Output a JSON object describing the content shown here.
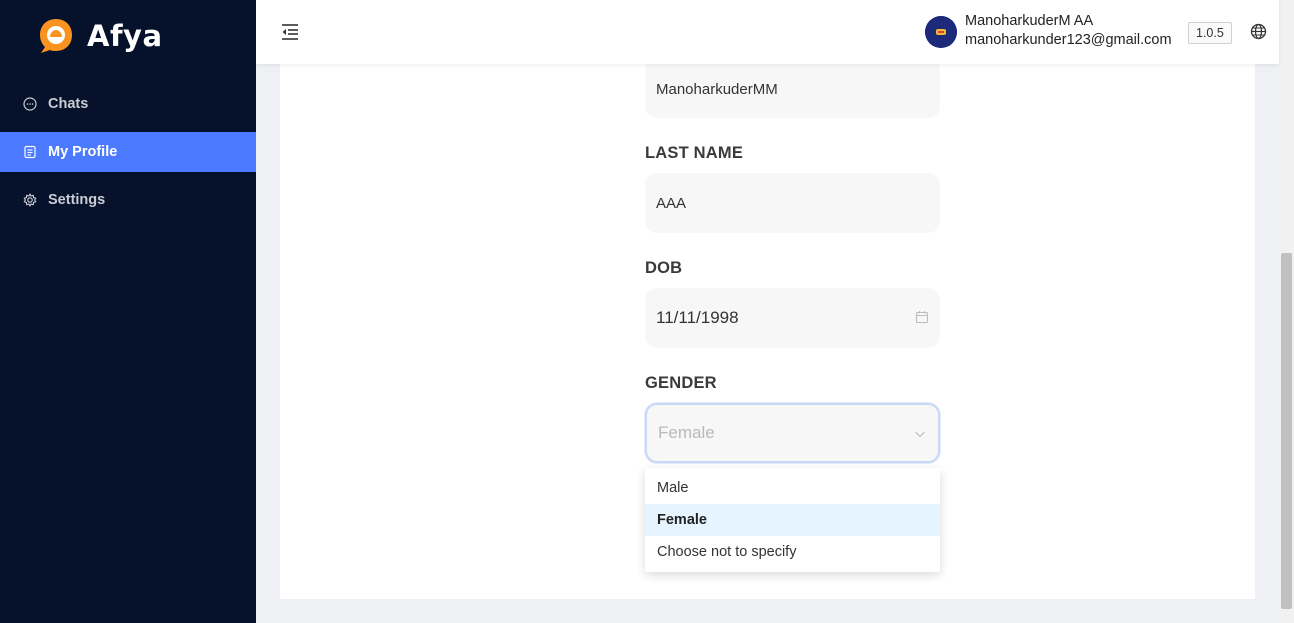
{
  "app": {
    "name": "Afya"
  },
  "sidebar": {
    "items": [
      {
        "label": "Chats",
        "icon": "chat-bubble-icon",
        "active": false
      },
      {
        "label": "My Profile",
        "icon": "profile-icon",
        "active": true
      },
      {
        "label": "Settings",
        "icon": "gear-icon",
        "active": false
      }
    ]
  },
  "header": {
    "user_name": "ManoharkuderM AA",
    "user_email": "manoharkunder123@gmail.com",
    "version": "1.0.5"
  },
  "form": {
    "first_name_value": "ManoharkuderMM",
    "last_name_label": "LAST NAME",
    "last_name_value": "AAA",
    "dob_label": "DOB",
    "dob_value": "11/11/1998",
    "gender_label": "GENDER",
    "gender_placeholder": "Female",
    "gender_options": [
      {
        "label": "Male",
        "selected": false
      },
      {
        "label": "Female",
        "selected": true
      },
      {
        "label": "Choose not to specify",
        "selected": false
      }
    ]
  },
  "colors": {
    "sidebar_bg": "#06122b",
    "active_item": "#4b79ff",
    "logo_orange": "#f7931e",
    "selected_option_bg": "#e6f4ff"
  }
}
